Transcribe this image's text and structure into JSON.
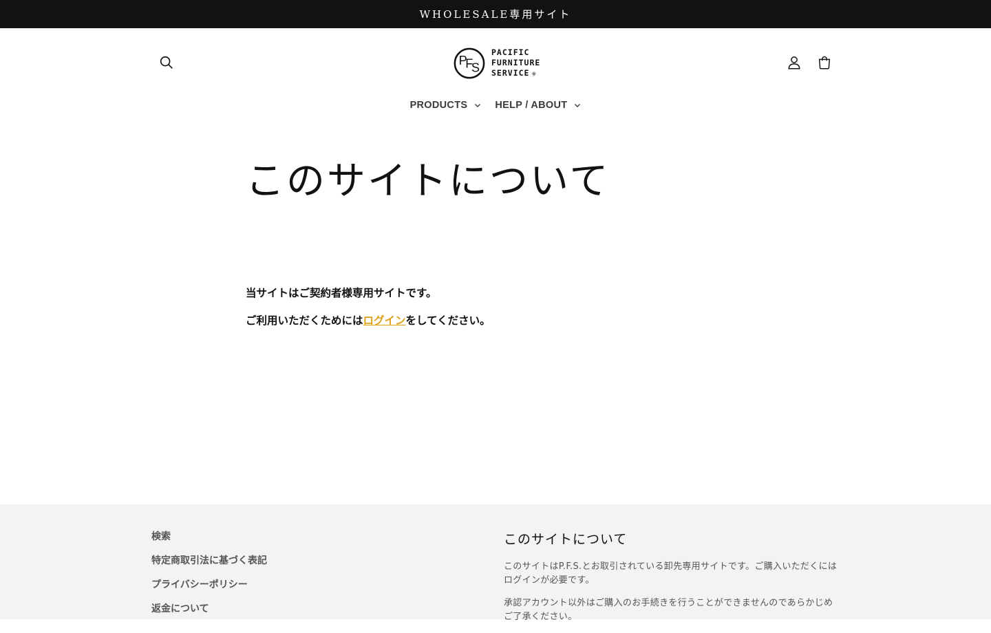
{
  "announcement": {
    "text": "WHOLESALE専用サイト"
  },
  "header": {
    "logo": {
      "lines": [
        "PACIFIC",
        "FURNITURE",
        "SERVICE"
      ],
      "registered": "®"
    },
    "icons": {
      "search": "search-icon",
      "account": "account-icon",
      "cart": "cart-icon"
    }
  },
  "nav": {
    "items": [
      {
        "label": "PRODUCTS"
      },
      {
        "label": "HELP / ABOUT"
      }
    ]
  },
  "main": {
    "title": "このサイトについて",
    "line1": "当サイトはご契約者様専用サイトです。",
    "line2_before": "ご利用いただくためには",
    "line2_link": "ログイン",
    "line2_after": "をしてください。"
  },
  "footer": {
    "links": [
      "検索",
      "特定商取引法に基づく表記",
      "プライバシーポリシー",
      "返金について"
    ],
    "about_title": "このサイトについて",
    "about_p1": "このサイトはP.F.S.とお取引されている卸先専用サイトです。ご購入いただくにはログインが必要です。",
    "about_p2": "承認アカウント以外はご購入のお手続きを行うことができませんのであらかじめご了承ください。"
  },
  "colors": {
    "announcement_bg": "#121212",
    "link": "#e0a21a",
    "footer_bg": "#f3f3f3"
  }
}
